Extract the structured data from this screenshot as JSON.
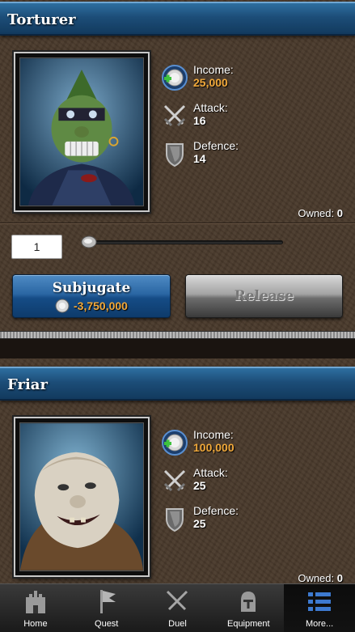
{
  "cards": [
    {
      "title": "Torturer",
      "income_label": "Income:",
      "income_value": "25,000",
      "attack_label": "Attack:",
      "attack_value": "16",
      "defence_label": "Defence:",
      "defence_value": "14",
      "owned_label": "Owned:",
      "owned_value": "0"
    },
    {
      "title": "Friar",
      "income_label": "Income:",
      "income_value": "100,000",
      "attack_label": "Attack:",
      "attack_value": "25",
      "defence_label": "Defence:",
      "defence_value": "25",
      "owned_label": "Owned:",
      "owned_value": "0"
    }
  ],
  "controls": {
    "quantity_value": "1",
    "slider_level": 0,
    "subjugate_label": "Subjugate",
    "subjugate_cost": "-3,750,000",
    "release_label": "Release"
  },
  "nav": [
    {
      "label": "Home",
      "icon": "castle-icon"
    },
    {
      "label": "Quest",
      "icon": "flag-icon"
    },
    {
      "label": "Duel",
      "icon": "crossed-swords-icon"
    },
    {
      "label": "Equipment",
      "icon": "helmet-icon"
    },
    {
      "label": "More...",
      "icon": "list-icon"
    }
  ],
  "colors": {
    "header_blue": "#1c4d78",
    "gold_value": "#f0a83a",
    "leather_bg": "#4a3a2c"
  }
}
